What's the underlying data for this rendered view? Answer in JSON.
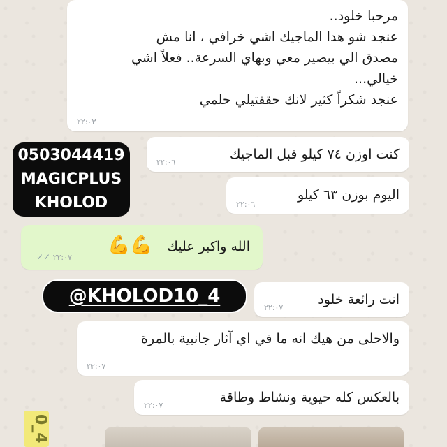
{
  "chat": {
    "messages": [
      {
        "id": "m1",
        "text": "مرحبا خلود..\nعنجد شو هدا الماجيك اشي خرافي ، انا مش\nمصدق الي بيصير معي وبهاي السرعة.. فعلاً اشي\nخيالي...\nعنجد شكراً كثير لانك حققتيلي حلمي",
        "time": "٢٢:٠٣"
      },
      {
        "id": "m2",
        "text": "كنت اوزن ٧٤ كيلو قبل الماجيك",
        "time": "٢٢:٠٦"
      },
      {
        "id": "m3",
        "text": "اليوم بوزن ٦٣ كيلو",
        "time": "٢٢:٠٦"
      },
      {
        "id": "m4",
        "text": "الله واكبر عليك",
        "time": "٢٢:٠٧",
        "emoji": "💪💪",
        "outgoing": true
      },
      {
        "id": "m5",
        "text": "انت رائعة خلود",
        "time": "٢٢:٠٧"
      },
      {
        "id": "m6",
        "text": "والاحلى من هيك انه ما في اي آثار جانبية بالمرة",
        "time": "٢٢:٠٧"
      },
      {
        "id": "m7",
        "text": "بالعكس كله حيوية ونشاط وطاقة",
        "time": "٢٢:٠٧"
      }
    ]
  },
  "overlay": {
    "phone": "0503044419",
    "brand": "MAGICPLUS",
    "name": "KHOLOD",
    "handle": "@KHOLOD10_4",
    "watermark": "0_4"
  },
  "colors": {
    "background": "#ebe6df",
    "incoming_bubble": "#ffffff",
    "outgoing_bubble": "#e2f7cb",
    "overlay": "#0c0c0c"
  }
}
